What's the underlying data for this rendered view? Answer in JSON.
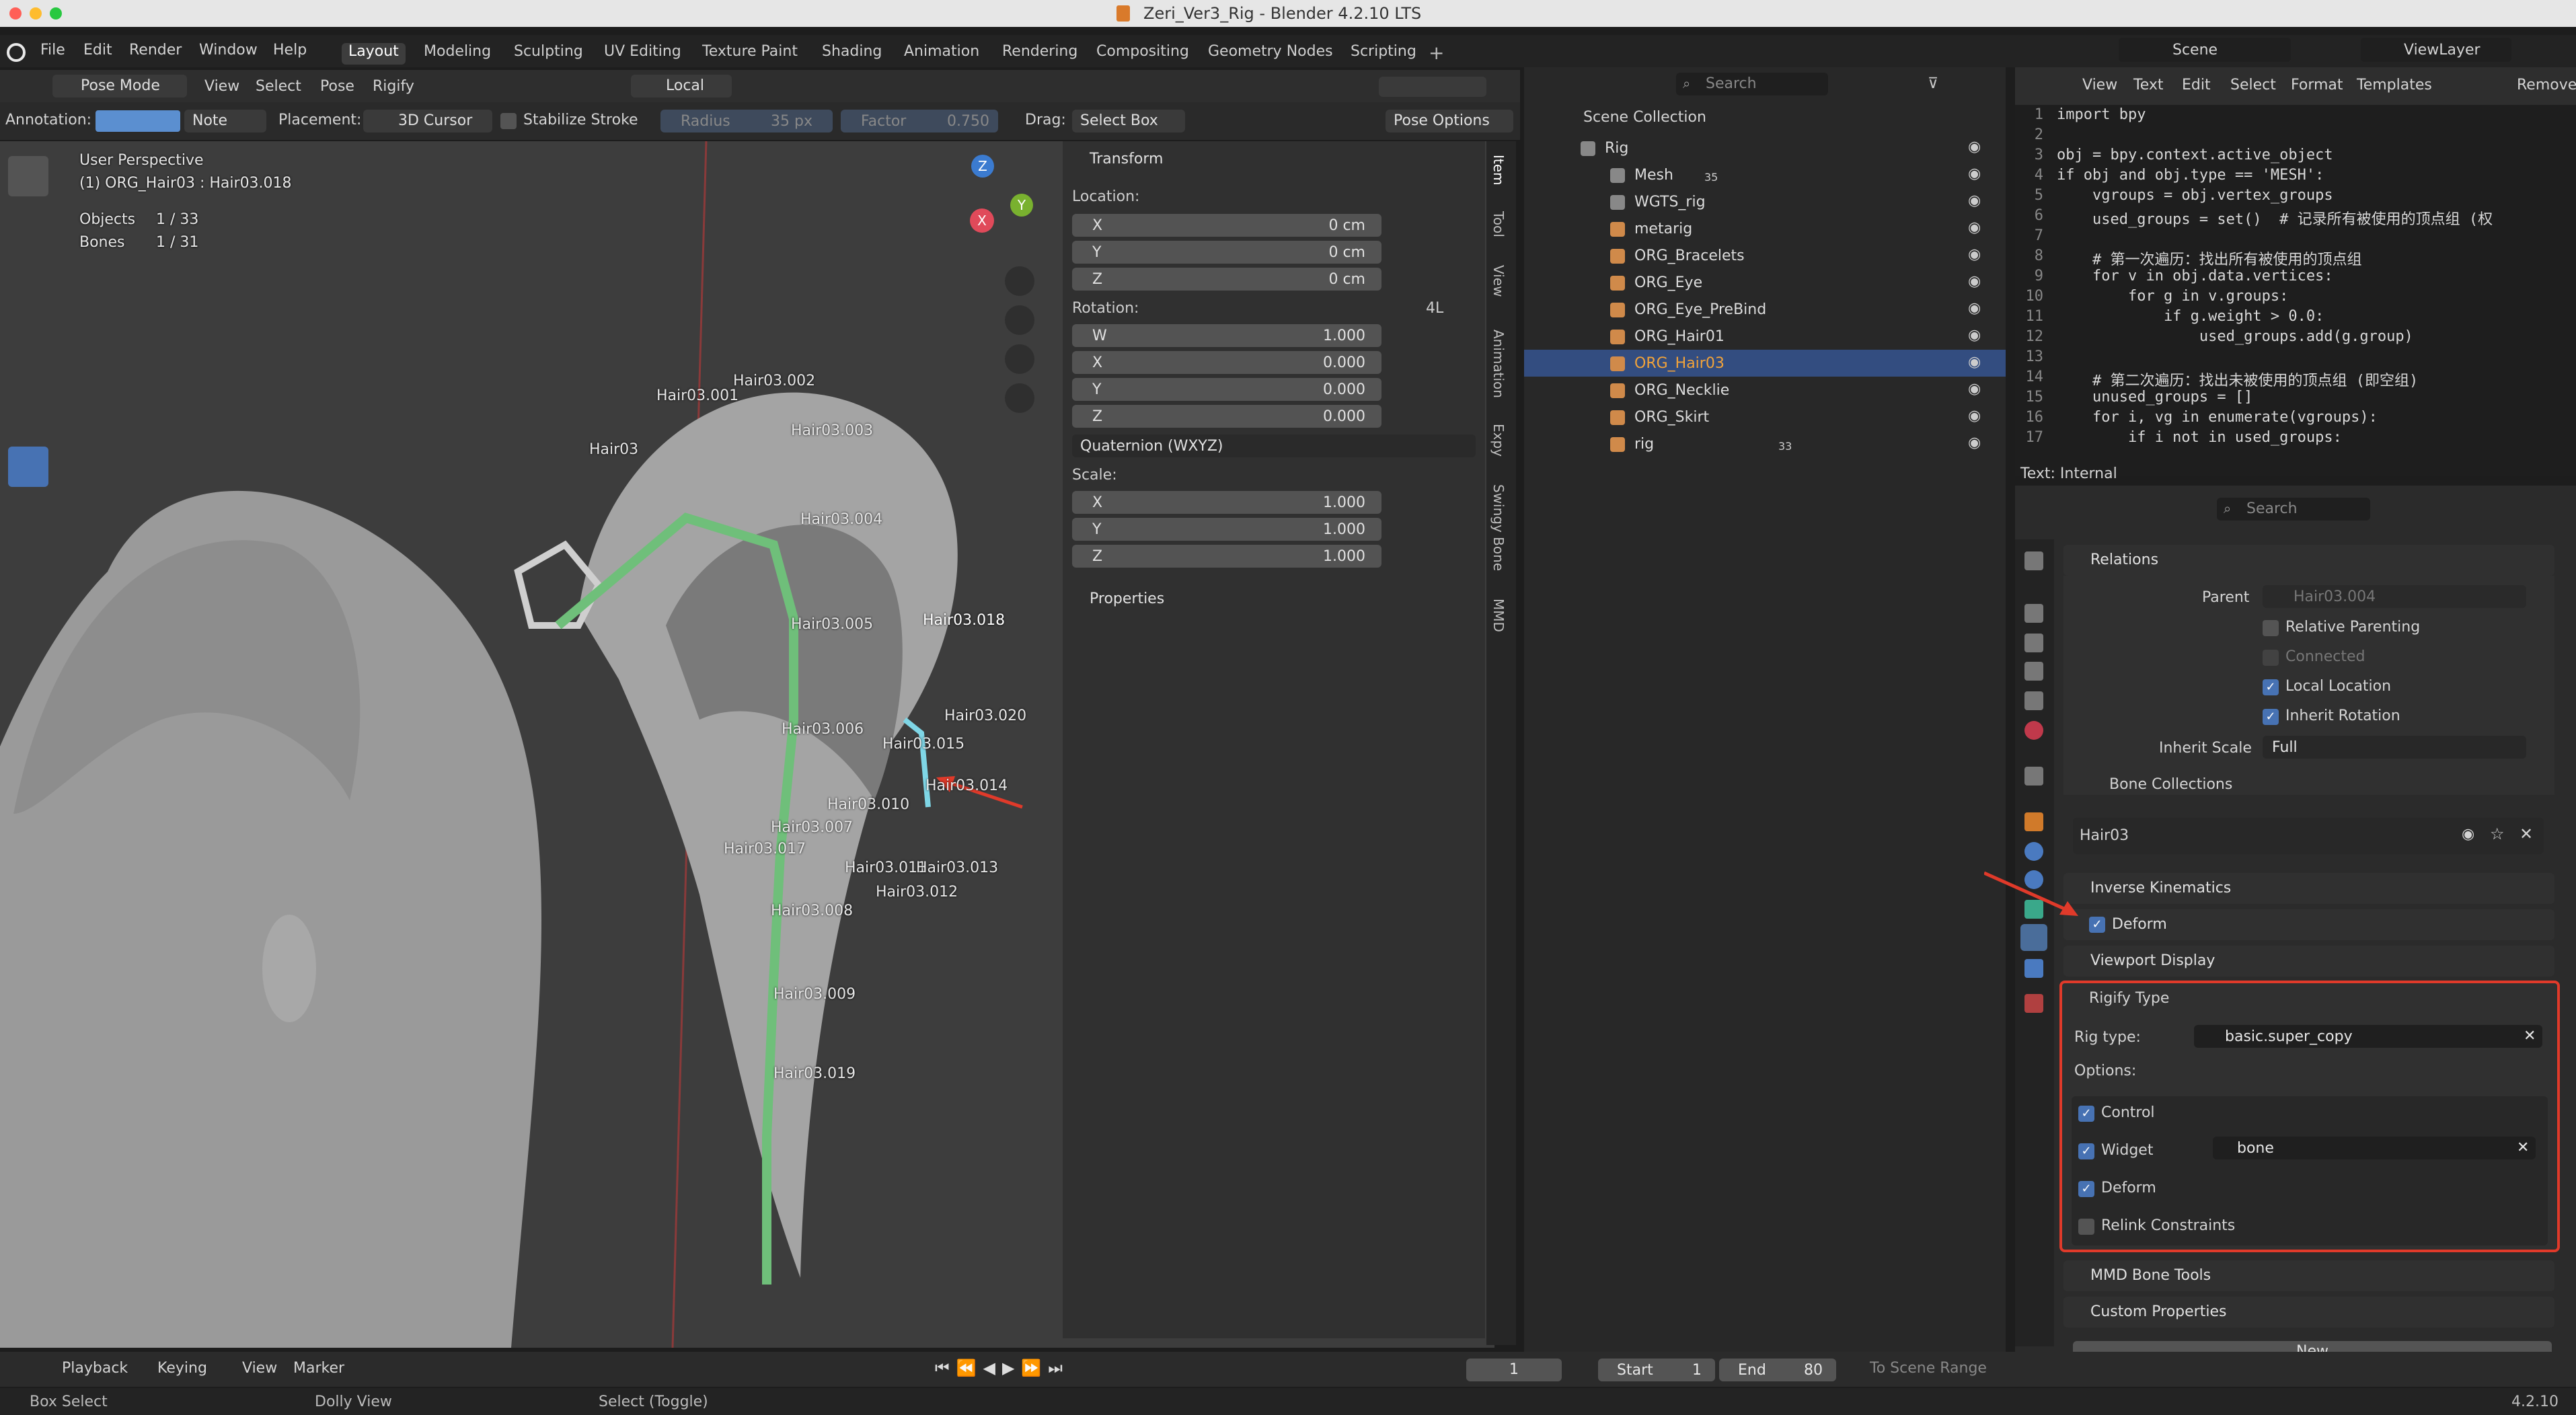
{
  "window": {
    "title": "Zeri_Ver3_Rig - Blender 4.2.10 LTS"
  },
  "menubar": {
    "menus": [
      "File",
      "Edit",
      "Render",
      "Window",
      "Help"
    ],
    "workspaces": [
      "Layout",
      "Modeling",
      "Sculpting",
      "UV Editing",
      "Texture Paint",
      "Shading",
      "Animation",
      "Rendering",
      "Compositing",
      "Geometry Nodes",
      "Scripting"
    ],
    "active_workspace": "Layout",
    "scene": "Scene",
    "view_layer": "ViewLayer"
  },
  "viewport_header": {
    "mode": "Pose Mode",
    "menus": [
      "View",
      "Select",
      "Pose",
      "Rigify"
    ],
    "orientation": "Local"
  },
  "tool_settings": {
    "annotation_label": "Annotation:",
    "annotation_color": "#5b8fd0",
    "note": "Note",
    "placement_label": "Placement:",
    "placement": "3D Cursor",
    "stabilize": "Stabilize Stroke",
    "radius_label": "Radius",
    "radius_value": "35 px",
    "factor_label": "Factor",
    "factor_value": "0.750",
    "drag_label": "Drag:",
    "drag_value": "Select Box",
    "pose_options": "Pose Options"
  },
  "overlay_info": {
    "perspective": "User Perspective",
    "active": "(1) ORG_Hair03 : Hair03.018",
    "objects_label": "Objects",
    "objects_value": "1 / 33",
    "bones_label": "Bones",
    "bones_value": "1 / 31"
  },
  "bones": [
    "Hair03.002",
    "Hair03.001",
    "Hair03",
    "Hair03.003",
    "Hair03.004",
    "Hair03.005",
    "Hair03.018",
    "Hair03.020",
    "Hair03.006",
    "Hair03.015",
    "Hair03.014",
    "Hair03.010",
    "Hair03.007",
    "Hair03.017",
    "Hair03.011",
    "Hair03.013",
    "Hair03.012",
    "Hair03.008",
    "Hair03.009",
    "Hair03.019"
  ],
  "nav_gizmo": {
    "z": "Z",
    "x": "X",
    "y": "Y"
  },
  "transform": {
    "title": "Transform",
    "location_label": "Location:",
    "location": [
      {
        "axis": "X",
        "value": "0 cm"
      },
      {
        "axis": "Y",
        "value": "0 cm"
      },
      {
        "axis": "Z",
        "value": "0 cm"
      }
    ],
    "rotation_label": "Rotation:",
    "rotation_mode_short": "4L",
    "rotation": [
      {
        "axis": "W",
        "value": "1.000"
      },
      {
        "axis": "X",
        "value": "0.000"
      },
      {
        "axis": "Y",
        "value": "0.000"
      },
      {
        "axis": "Z",
        "value": "0.000"
      }
    ],
    "rotation_mode": "Quaternion (WXYZ)",
    "scale_label": "Scale:",
    "scale": [
      {
        "axis": "X",
        "value": "1.000"
      },
      {
        "axis": "Y",
        "value": "1.000"
      },
      {
        "axis": "Z",
        "value": "1.000"
      }
    ],
    "properties": "Properties"
  },
  "side_tabs": [
    "Item",
    "Tool",
    "View",
    "Animation",
    "Expy",
    "Swingy Bone",
    "MMD"
  ],
  "outliner": {
    "search_placeholder": "Search",
    "root": "Scene Collection",
    "rows": [
      {
        "name": "Rig",
        "indent": 1
      },
      {
        "name": "Mesh",
        "indent": 2,
        "badge": "35"
      },
      {
        "name": "WGTS_rig",
        "indent": 2
      },
      {
        "name": "metarig",
        "indent": 2
      },
      {
        "name": "ORG_Bracelets",
        "indent": 2
      },
      {
        "name": "ORG_Eye",
        "indent": 2
      },
      {
        "name": "ORG_Eye_PreBind",
        "indent": 2
      },
      {
        "name": "ORG_Hair01",
        "indent": 2
      },
      {
        "name": "ORG_Hair03",
        "indent": 2,
        "selected": true
      },
      {
        "name": "ORG_Necklie",
        "indent": 2
      },
      {
        "name": "ORG_Skirt",
        "indent": 2
      },
      {
        "name": "rig",
        "indent": 2,
        "badge": "33"
      }
    ]
  },
  "text_editor": {
    "menus": [
      "View",
      "Text",
      "Edit",
      "Select",
      "Format",
      "Templates"
    ],
    "remove": "Remove",
    "status": "Text: Internal",
    "lines": [
      "import bpy",
      "",
      "obj = bpy.context.active_object",
      "if obj and obj.type == 'MESH':",
      "    vgroups = obj.vertex_groups",
      "    used_groups = set()  # 记录所有被使用的顶点组 (权",
      "",
      "    # 第一次遍历：找出所有被使用的顶点组",
      "    for v in obj.data.vertices:",
      "        for g in v.groups:",
      "            if g.weight > 0.0:",
      "                used_groups.add(g.group)",
      "",
      "    # 第二次遍历：找出未被使用的顶点组 (即空组)",
      "    unused_groups = []",
      "    for i, vg in enumerate(vgroups):",
      "        if i not in used_groups:"
    ]
  },
  "properties": {
    "search_placeholder": "Search",
    "relations": {
      "title": "Relations",
      "parent_label": "Parent",
      "parent_value": "Hair03.004",
      "relative_parenting": "Relative Parenting",
      "connected": "Connected",
      "local_location": "Local Location",
      "inherit_rotation": "Inherit Rotation",
      "inherit_scale_label": "Inherit Scale",
      "inherit_scale_value": "Full"
    },
    "bone_collections": {
      "title": "Bone Collections",
      "item": "Hair03"
    },
    "inverse_kinematics": "Inverse Kinematics",
    "deform": "Deform",
    "viewport_display": "Viewport Display",
    "rigify_type": {
      "title": "Rigify Type",
      "rig_type_label": "Rig type:",
      "rig_type_value": "basic.super_copy",
      "options_label": "Options:",
      "control": "Control",
      "widget": "Widget",
      "widget_value": "bone",
      "deform": "Deform",
      "relink": "Relink Constraints"
    },
    "mmd_bone_tools": "MMD Bone Tools",
    "custom_properties": "Custom Properties",
    "new": "New"
  },
  "timeline": {
    "menus": [
      "Playback",
      "Keying",
      "View",
      "Marker"
    ],
    "current_frame": "1",
    "start_label": "Start",
    "start": "1",
    "end_label": "End",
    "end": "80",
    "range": "To Scene Range"
  },
  "statusbar": {
    "items": [
      "Box Select",
      "Dolly View",
      "Select (Toggle)"
    ],
    "version": "4.2.10"
  },
  "colors": {
    "accent": "#4772b3",
    "highlight_box": "#e03a2a",
    "bone_green": "#6fbf7a",
    "selected_bone": "#7fd6e6"
  }
}
